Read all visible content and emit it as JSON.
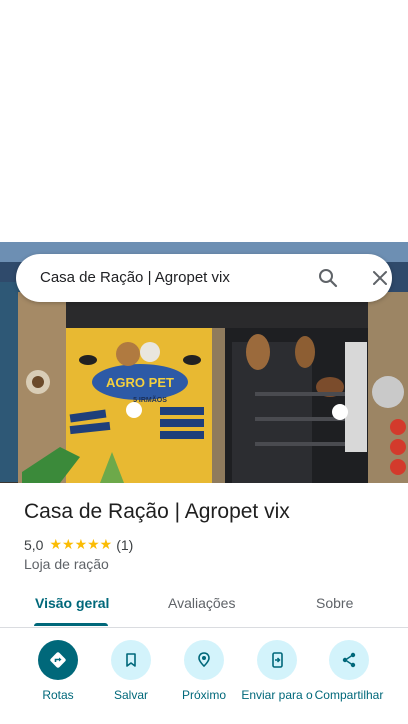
{
  "search": {
    "query": "Casa de Ração | Agropet vix"
  },
  "photo": {
    "sign_text": "AGRO PET",
    "sign_subtext": "5 IRMÃOS"
  },
  "place": {
    "title": "Casa de Ração | Agropet vix",
    "rating": "5,0",
    "stars": "★★★★★",
    "review_count": "(1)",
    "category": "Loja de ração"
  },
  "tabs": [
    {
      "label": "Visão geral",
      "active": true
    },
    {
      "label": "Avaliações",
      "active": false
    },
    {
      "label": "Sobre",
      "active": false
    }
  ],
  "actions": [
    {
      "label": "Rotas",
      "icon": "directions-icon"
    },
    {
      "label": "Salvar",
      "icon": "bookmark-icon"
    },
    {
      "label": "Próximo",
      "icon": "nearby-icon"
    },
    {
      "label": "Enviar para o",
      "icon": "send-to-phone-icon"
    },
    {
      "label": "Compartilhar",
      "icon": "share-icon"
    }
  ],
  "colors": {
    "accent": "#00687a",
    "action_bg": "#d3f3fb",
    "star": "#fbbc04"
  }
}
